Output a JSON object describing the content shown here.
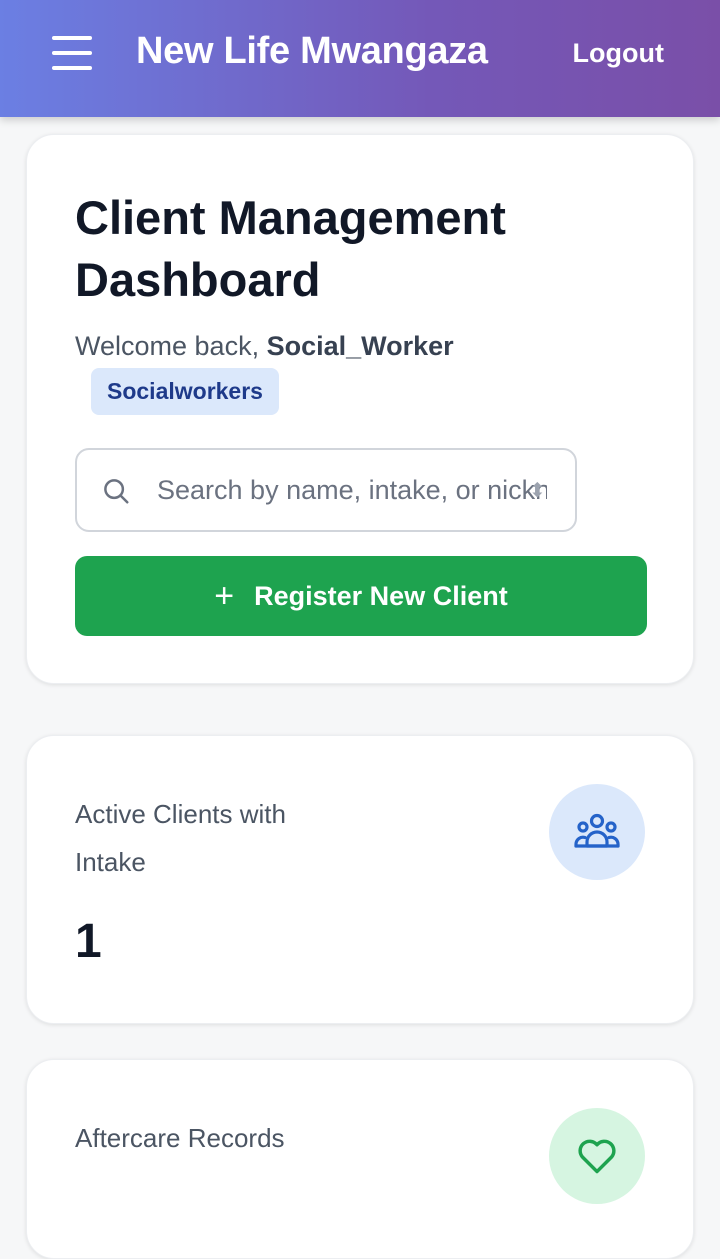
{
  "header": {
    "title": "New Life Mwangaza",
    "logout_label": "Logout"
  },
  "dashboard": {
    "title": "Client Management Dashboard",
    "welcome_prefix": "Welcome back, ",
    "username": "Social_Worker",
    "role": "Socialworkers",
    "search": {
      "placeholder": "Search by name, intake, or nickname",
      "value": ""
    },
    "register_label": "Register New Client"
  },
  "stats": [
    {
      "label": "Active Clients with Intake",
      "value": "1",
      "icon": "users-icon",
      "color": "#2563c9"
    },
    {
      "label": "Aftercare Records",
      "value": "",
      "icon": "heart-icon",
      "color": "#1ea34f"
    }
  ],
  "colors": {
    "header_gradient_start": "#6b7fe3",
    "header_gradient_end": "#7a4fa8",
    "primary_button": "#1ea34f",
    "badge_bg": "#dbe8fb",
    "badge_text": "#1e3a8a"
  }
}
